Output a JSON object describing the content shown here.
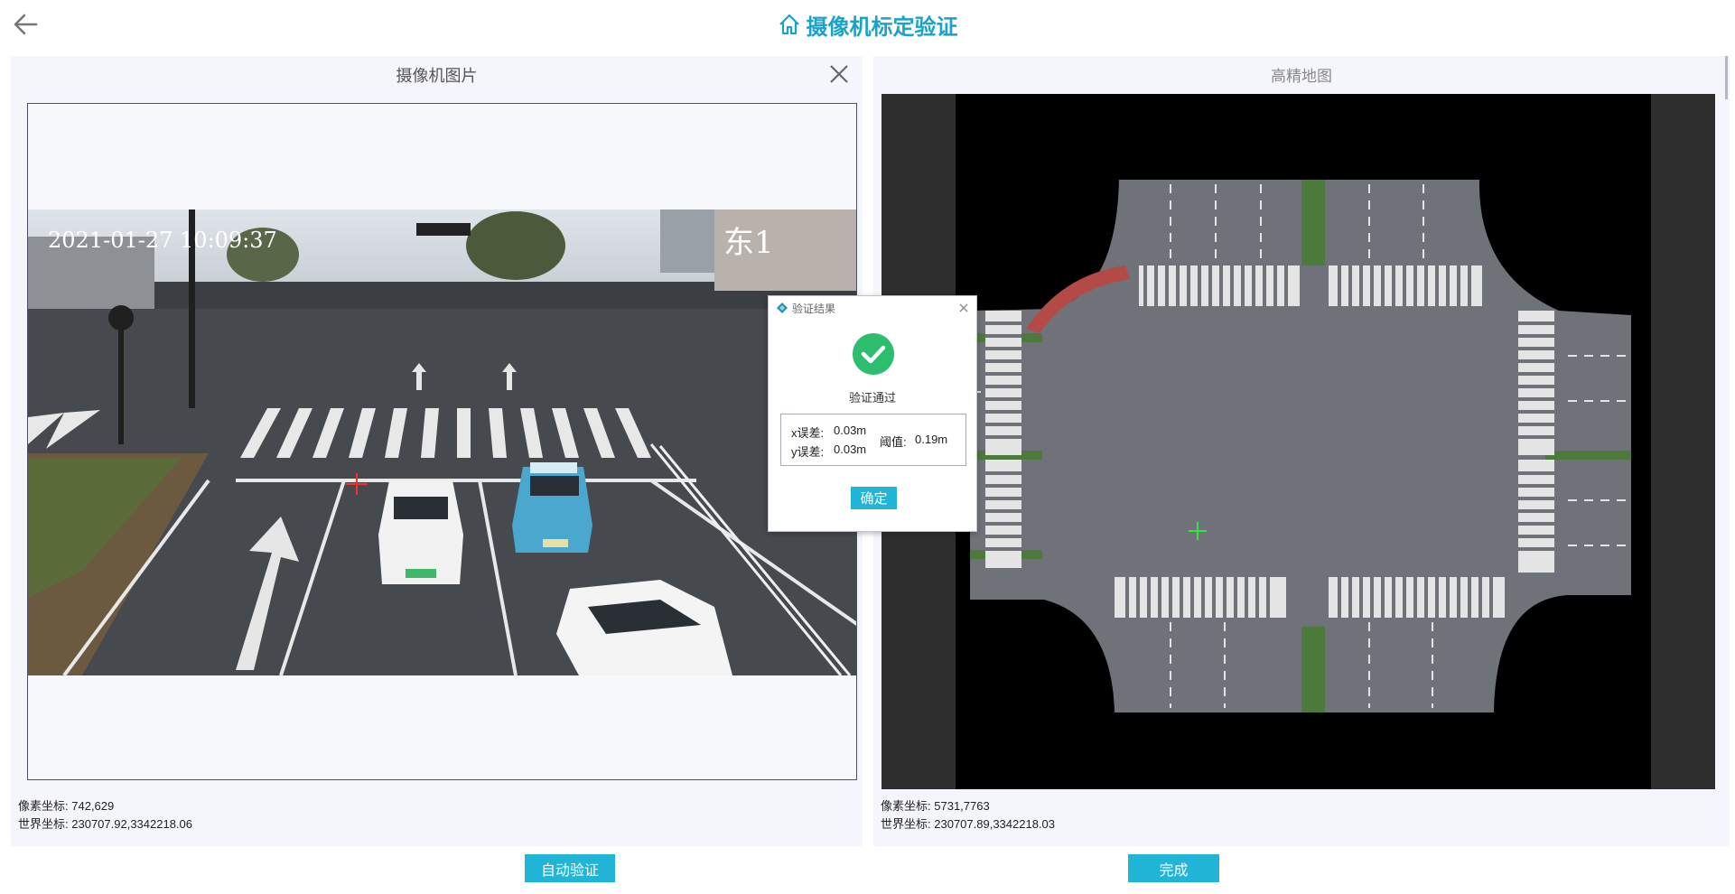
{
  "header": {
    "title": "摄像机标定验证",
    "back_icon": "arrow-left-icon",
    "home_icon": "home-icon"
  },
  "colors": {
    "accent": "#20b4d6",
    "title": "#1aa3c9",
    "success": "#2dbd6e"
  },
  "left_panel": {
    "title": "摄像机图片",
    "photo_overlay": {
      "timestamp": "2021-01-27  10:09:37",
      "camera_label": "东1"
    },
    "pixel_coord_label": "像素坐标:",
    "pixel_coord_value": "742,629",
    "world_coord_label": "世界坐标:",
    "world_coord_value": "230707.92,3342218.06"
  },
  "right_panel": {
    "title": "高精地图",
    "pixel_coord_label": "像素坐标:",
    "pixel_coord_value": "5731,7763",
    "world_coord_label": "世界坐标:",
    "world_coord_value": "230707.89,3342218.03"
  },
  "dialog": {
    "title": "验证结果",
    "status": "验证通过",
    "x_error_label": "x误差:",
    "x_error_value": "0.03m",
    "y_error_label": "y误差:",
    "y_error_value": "0.03m",
    "threshold_label": "阈值:",
    "threshold_value": "0.19m",
    "ok_label": "确定"
  },
  "buttons": {
    "auto_verify": "自动验证",
    "done": "完成"
  }
}
